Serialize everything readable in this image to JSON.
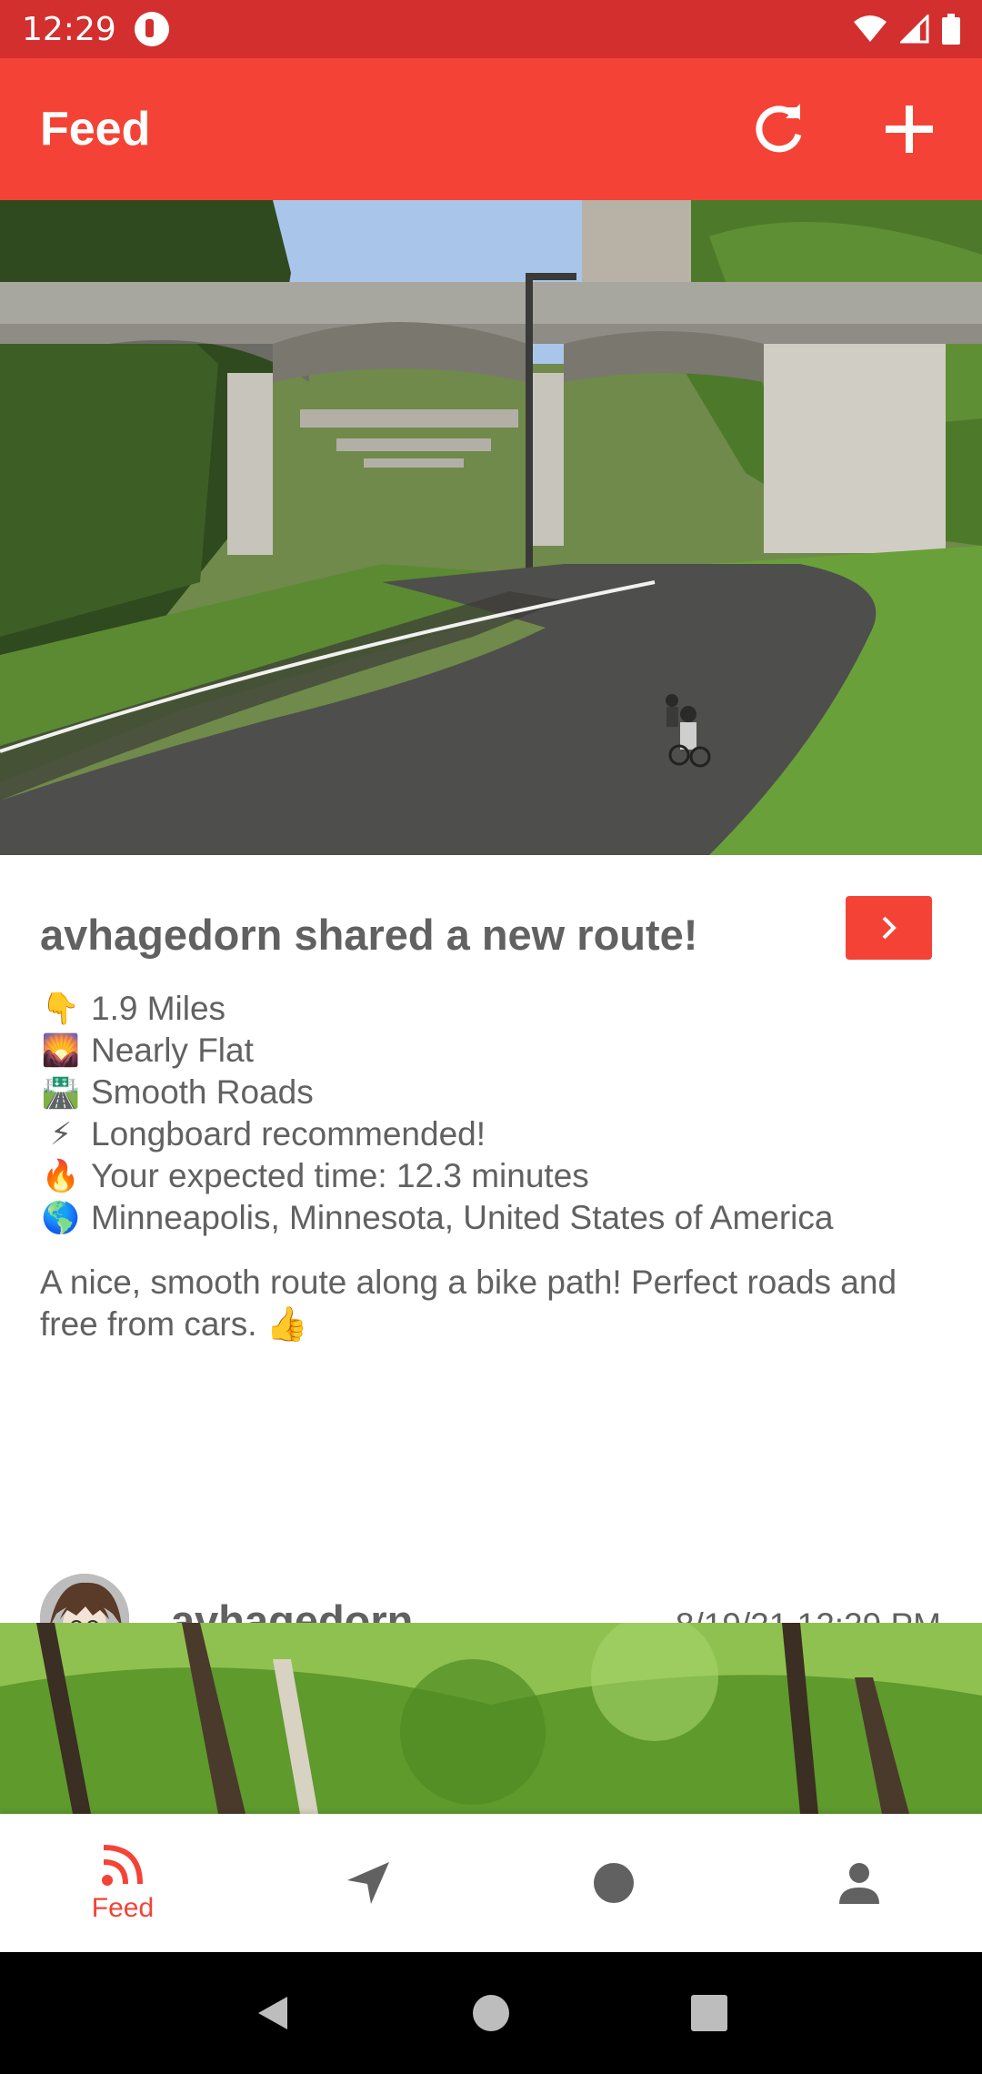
{
  "status_bar": {
    "time": "12:29"
  },
  "app_bar": {
    "title": "Feed",
    "icons": [
      "refresh-icon",
      "add-icon"
    ]
  },
  "post": {
    "title": "avhagedorn shared a new route!",
    "stats": [
      {
        "icon": "👇",
        "text": "1.9 Miles"
      },
      {
        "icon": "🌄",
        "text": "Nearly Flat"
      },
      {
        "icon": "🛣️",
        "text": "Smooth Roads"
      },
      {
        "icon": "⚡",
        "text": "Longboard recommended!"
      },
      {
        "icon": "🔥",
        "text": "Your expected time: 12.3 minutes"
      },
      {
        "icon": "🌎",
        "text": "Minneapolis, Minnesota, United States of America"
      }
    ],
    "description": "A nice, smooth route along a bike path! Perfect roads and free from cars. 👍",
    "username": "avhagedorn",
    "timestamp": "8/19/21 12:29 PM"
  },
  "bottom_nav": {
    "items": [
      {
        "icon": "rss-feed-icon",
        "label": "Feed",
        "active": true
      },
      {
        "icon": "navigation-icon",
        "label": ""
      },
      {
        "icon": "record-icon",
        "label": ""
      },
      {
        "icon": "person-icon",
        "label": ""
      }
    ]
  },
  "colors": {
    "primary": "#f44336",
    "status_bar": "#d32f2f",
    "text": "#616161"
  }
}
